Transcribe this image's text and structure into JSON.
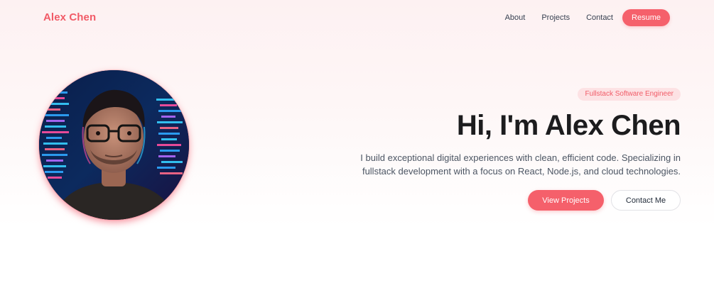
{
  "nav": {
    "brand": "Alex Chen",
    "links": [
      "About",
      "Projects",
      "Contact"
    ],
    "resume_label": "Resume"
  },
  "hero": {
    "badge": "Fullstack Software Engineer",
    "headline": "Hi, I'm Alex Chen",
    "description": "I build exceptional digital experiences with clean, efficient code. Specializing in fullstack development with a focus on React, Node.js, and cloud technologies.",
    "primary_cta": "View Projects",
    "secondary_cta": "Contact Me"
  },
  "colors": {
    "accent": "#f5606b",
    "brand_text": "#f15b67",
    "badge_bg": "#fde2e4",
    "heading": "#1c1c1e",
    "body_text": "#4b5563"
  }
}
